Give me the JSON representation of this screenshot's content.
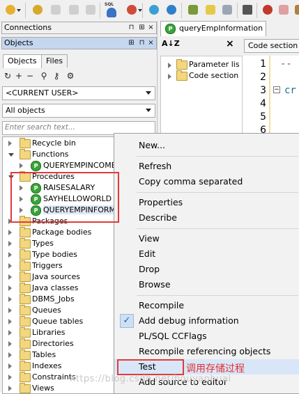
{
  "colors": {
    "highlight_box": "#e03a3a",
    "annotation": "#e03030",
    "menu_selected": "#d9e6f7",
    "panel_active": "#c5d7ef"
  },
  "toolbar": {
    "buttons": [
      "key-icon",
      "gear-icon",
      "pen-icon",
      "export-icon",
      "import-icon",
      "sql-db-icon",
      "db-icon",
      "db-tool-icon",
      "filter-icon",
      "checklist-icon",
      "calendar-icon",
      "wrench-icon",
      "debug-icon",
      "eraser-icon",
      "window-icon"
    ],
    "sql_label": "SQL"
  },
  "connections_panel": {
    "title": "Connections",
    "buttons": [
      "⊓",
      "⊞",
      "×"
    ]
  },
  "objects_panel": {
    "title": "Objects",
    "tabs": [
      "Objects",
      "Files"
    ],
    "user_select": "<CURRENT USER>",
    "filter_select": "All objects",
    "search_placeholder": "Enter search text...",
    "tree": [
      {
        "label": "Recycle bin",
        "type": "folder",
        "expanded": false,
        "level": 0
      },
      {
        "label": "Functions",
        "type": "folder",
        "expanded": true,
        "level": 0
      },
      {
        "label": "QUERYEMPINCOME",
        "type": "proc",
        "level": 1
      },
      {
        "label": "Procedures",
        "type": "folder",
        "expanded": true,
        "level": 0
      },
      {
        "label": "RAISESALARY",
        "type": "proc",
        "level": 1
      },
      {
        "label": "SAYHELLOWORLD",
        "type": "proc",
        "level": 1
      },
      {
        "label": "QUERYEMPINFORM",
        "type": "proc",
        "level": 1,
        "selected": true
      },
      {
        "label": "Packages",
        "type": "folder",
        "level": 0
      },
      {
        "label": "Package bodies",
        "type": "folder",
        "level": 0
      },
      {
        "label": "Types",
        "type": "folder",
        "level": 0
      },
      {
        "label": "Type bodies",
        "type": "folder",
        "level": 0
      },
      {
        "label": "Triggers",
        "type": "folder",
        "level": 0
      },
      {
        "label": "Java sources",
        "type": "folder",
        "level": 0
      },
      {
        "label": "Java classes",
        "type": "folder",
        "level": 0
      },
      {
        "label": "DBMS_Jobs",
        "type": "folder",
        "level": 0
      },
      {
        "label": "Queues",
        "type": "folder",
        "level": 0
      },
      {
        "label": "Queue tables",
        "type": "folder",
        "level": 0
      },
      {
        "label": "Libraries",
        "type": "folder",
        "level": 0
      },
      {
        "label": "Directories",
        "type": "folder",
        "level": 0
      },
      {
        "label": "Tables",
        "type": "folder",
        "level": 0
      },
      {
        "label": "Indexes",
        "type": "folder",
        "level": 0
      },
      {
        "label": "Constraints",
        "type": "folder",
        "level": 0
      },
      {
        "label": "Views",
        "type": "folder",
        "level": 0
      }
    ]
  },
  "editor": {
    "tab_label": "queryEmpInformation",
    "code_section_button": "Code section",
    "outline": [
      "Parameter lis",
      "Code section"
    ],
    "line_numbers": [
      "1",
      "2",
      "3",
      "4",
      "5",
      "6"
    ],
    "code_lines": {
      "1": "--",
      "3": "cr"
    }
  },
  "context_menu": {
    "items": [
      {
        "label": "New..."
      },
      {
        "label": "Refresh"
      },
      {
        "label": "Copy comma separated"
      },
      {
        "label": "Properties"
      },
      {
        "label": "Describe"
      },
      {
        "label": "View"
      },
      {
        "label": "Edit"
      },
      {
        "label": "Drop"
      },
      {
        "label": "Browse"
      },
      {
        "label": "Recompile"
      },
      {
        "label": "Add debug information",
        "checked": true
      },
      {
        "label": "PL/SQL CCFlags"
      },
      {
        "label": "Recompile referencing objects"
      },
      {
        "label": "Test",
        "selected": true
      },
      {
        "label": "Add source to editor"
      }
    ]
  },
  "annotation": "调用存储过程",
  "watermark": "https://blog.csdn.net/houyanhual"
}
